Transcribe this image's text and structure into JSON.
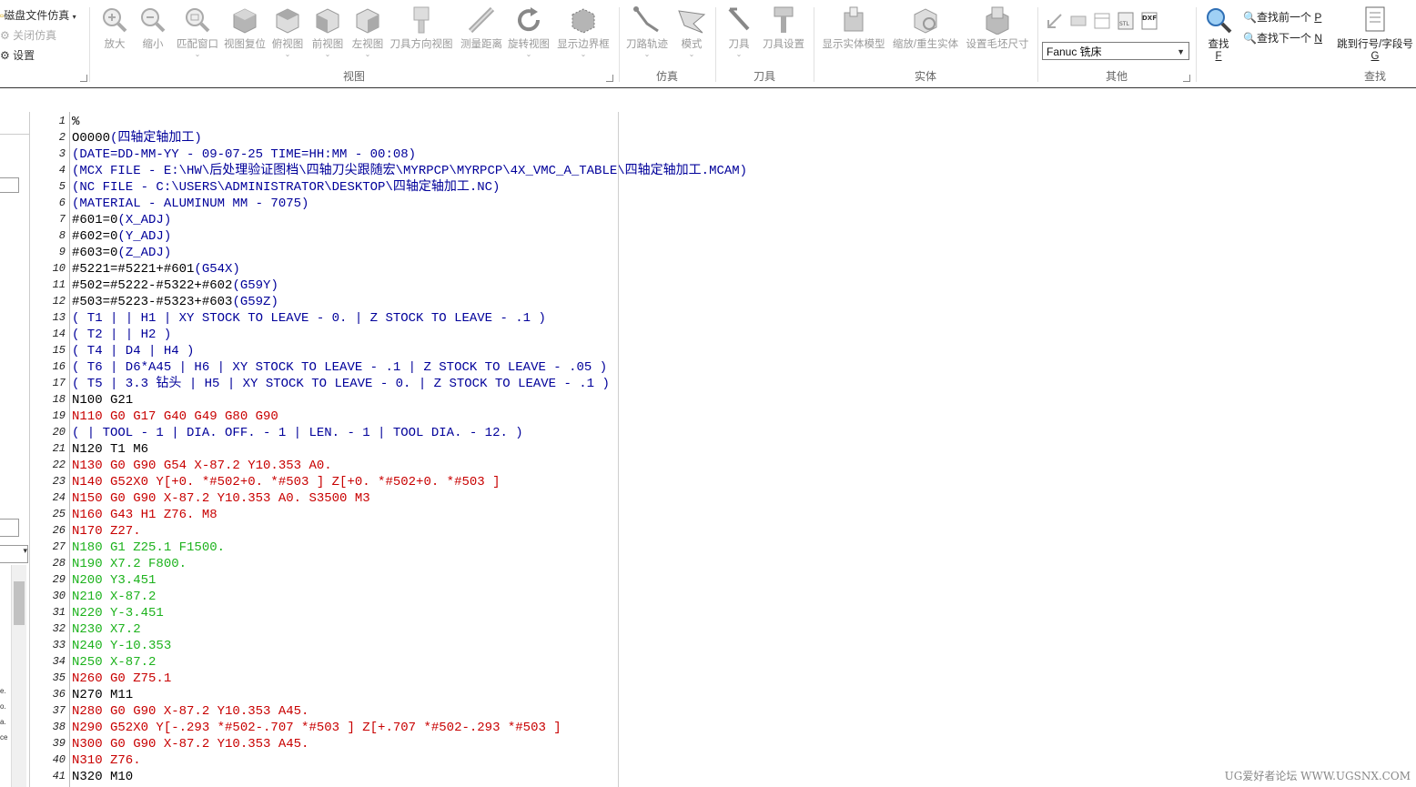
{
  "ribbon": {
    "left_menu": [
      "磁盘文件仿真",
      "关闭仿真",
      "设置"
    ],
    "view_buttons": [
      "放大",
      "缩小",
      "匹配窗口",
      "视图复位",
      "俯视图",
      "前视图",
      "左视图",
      "刀具方向视图",
      "测量距离",
      "旋转视图",
      "显示边界框"
    ],
    "view_group": "视图",
    "sim_buttons": [
      "刀路轨迹",
      "模式"
    ],
    "sim_group": "仿真",
    "tool_buttons": [
      "刀具",
      "刀具设置"
    ],
    "tool_group": "刀具",
    "solid_buttons": [
      "显示实体模型",
      "缩放/重生实体",
      "设置毛坯尺寸"
    ],
    "solid_group": "实体",
    "other_group": "其他",
    "machine_select": "Fanuc 铣床",
    "find_button": "查找",
    "find_key": "F",
    "find_prev": "查找前一个",
    "find_prev_key": "P",
    "find_next": "查找下一个",
    "find_next_key": "N",
    "goto_button": "跳到行号/字段号",
    "goto_key": "G",
    "find_group": "查找"
  },
  "left_panel_snippets": [
    "e.",
    "o.",
    "a.",
    "ce"
  ],
  "code_lines": [
    {
      "n": "1",
      "segs": [
        [
          "%",
          "blk"
        ]
      ]
    },
    {
      "n": "2",
      "segs": [
        [
          "O0000",
          "blk"
        ],
        [
          "(四轴定轴加工)",
          "blu"
        ]
      ]
    },
    {
      "n": "3",
      "segs": [
        [
          "(DATE=DD-MM-YY - 09-07-25 TIME=HH:MM - 00:08)",
          "blu"
        ]
      ]
    },
    {
      "n": "4",
      "segs": [
        [
          "(MCX FILE - E:\\HW\\后处理验证图档\\四轴刀尖跟随宏\\MYRPCP\\MYRPCP\\4X_VMC_A_TABLE\\四轴定轴加工.MCAM)",
          "blu"
        ]
      ]
    },
    {
      "n": "5",
      "segs": [
        [
          "(NC FILE - C:\\USERS\\ADMINISTRATOR\\DESKTOP\\四轴定轴加工.NC)",
          "blu"
        ]
      ]
    },
    {
      "n": "6",
      "segs": [
        [
          "(MATERIAL - ALUMINUM MM - 7075)",
          "blu"
        ]
      ]
    },
    {
      "n": "7",
      "segs": [
        [
          "#601=0",
          "blk"
        ],
        [
          "(X_ADJ)",
          "blu"
        ]
      ]
    },
    {
      "n": "8",
      "segs": [
        [
          "#602=0",
          "blk"
        ],
        [
          "(Y_ADJ)",
          "blu"
        ]
      ]
    },
    {
      "n": "9",
      "segs": [
        [
          "#603=0",
          "blk"
        ],
        [
          "(Z_ADJ)",
          "blu"
        ]
      ]
    },
    {
      "n": "10",
      "segs": [
        [
          "#5221=#5221+#601",
          "blk"
        ],
        [
          "(G54X)",
          "blu"
        ]
      ]
    },
    {
      "n": "11",
      "segs": [
        [
          "#502=#5222-#5322+#602",
          "blk"
        ],
        [
          "(G59Y)",
          "blu"
        ]
      ]
    },
    {
      "n": "12",
      "segs": [
        [
          "#503=#5223-#5323+#603",
          "blk"
        ],
        [
          "(G59Z)",
          "blu"
        ]
      ]
    },
    {
      "n": "13",
      "segs": [
        [
          "( T1 | | H1 | XY STOCK TO LEAVE - 0. | Z STOCK TO LEAVE - .1 )",
          "blu"
        ]
      ]
    },
    {
      "n": "14",
      "segs": [
        [
          "( T2 | | H2 )",
          "blu"
        ]
      ]
    },
    {
      "n": "15",
      "segs": [
        [
          "( T4 | D4 | H4 )",
          "blu"
        ]
      ]
    },
    {
      "n": "16",
      "segs": [
        [
          "( T6 | D6*A45 | H6 | XY STOCK TO LEAVE - .1 | Z STOCK TO LEAVE - .05 )",
          "blu"
        ]
      ]
    },
    {
      "n": "17",
      "segs": [
        [
          "( T5 | 3.3 钻头 | H5 | XY STOCK TO LEAVE - 0. | Z STOCK TO LEAVE - .1 )",
          "blu"
        ]
      ]
    },
    {
      "n": "18",
      "segs": [
        [
          "N100 G21",
          "blk"
        ]
      ]
    },
    {
      "n": "19",
      "segs": [
        [
          "N110 G0 G17 G40 G49 G80 G90",
          "red"
        ]
      ]
    },
    {
      "n": "20",
      "segs": [
        [
          "( | TOOL - 1 | DIA. OFF. - 1 | LEN. - 1 | TOOL DIA. - 12. )",
          "blu"
        ]
      ]
    },
    {
      "n": "21",
      "segs": [
        [
          "N120 T1 M6",
          "blk"
        ]
      ]
    },
    {
      "n": "22",
      "segs": [
        [
          "N130 G0 G90 G54 X-87.2 Y10.353 A0.",
          "red"
        ]
      ]
    },
    {
      "n": "23",
      "segs": [
        [
          "N140 G52X0 Y[+0. *#502+0. *#503 ] Z[+0. *#502+0. *#503 ]",
          "red"
        ]
      ]
    },
    {
      "n": "24",
      "segs": [
        [
          "N150 G0 G90 X-87.2 Y10.353 A0. S3500 M3",
          "red"
        ]
      ]
    },
    {
      "n": "25",
      "segs": [
        [
          "N160 G43 H1 Z76. M8",
          "red"
        ]
      ]
    },
    {
      "n": "26",
      "segs": [
        [
          "N170 Z27.",
          "red"
        ]
      ]
    },
    {
      "n": "27",
      "segs": [
        [
          "N180 G1 Z25.1 F1500.",
          "grn"
        ]
      ]
    },
    {
      "n": "28",
      "segs": [
        [
          "N190 X7.2 F800.",
          "grn"
        ]
      ]
    },
    {
      "n": "29",
      "segs": [
        [
          "N200 Y3.451",
          "grn"
        ]
      ]
    },
    {
      "n": "30",
      "segs": [
        [
          "N210 X-87.2",
          "grn"
        ]
      ]
    },
    {
      "n": "31",
      "segs": [
        [
          "N220 Y-3.451",
          "grn"
        ]
      ]
    },
    {
      "n": "32",
      "segs": [
        [
          "N230 X7.2",
          "grn"
        ]
      ]
    },
    {
      "n": "33",
      "segs": [
        [
          "N240 Y-10.353",
          "grn"
        ]
      ]
    },
    {
      "n": "34",
      "segs": [
        [
          "N250 X-87.2",
          "grn"
        ]
      ]
    },
    {
      "n": "35",
      "segs": [
        [
          "N260 G0 Z75.1",
          "red"
        ]
      ]
    },
    {
      "n": "36",
      "segs": [
        [
          "N270 M11",
          "blk"
        ]
      ]
    },
    {
      "n": "37",
      "segs": [
        [
          "N280 G0 G90 X-87.2 Y10.353 A45.",
          "red"
        ]
      ]
    },
    {
      "n": "38",
      "segs": [
        [
          "N290 G52X0 Y[-.293 *#502-.707 *#503 ] Z[+.707 *#502-.293 *#503 ]",
          "red"
        ]
      ]
    },
    {
      "n": "39",
      "segs": [
        [
          "N300 G0 G90 X-87.2 Y10.353 A45.",
          "red"
        ]
      ]
    },
    {
      "n": "40",
      "segs": [
        [
          "N310 Z76.",
          "red"
        ]
      ]
    },
    {
      "n": "41",
      "segs": [
        [
          "N320 M10",
          "blk"
        ]
      ]
    }
  ],
  "watermark": "UG爱好者论坛 WWW.UGSNX.COM",
  "colors": {
    "blk": "#000000",
    "blu": "#00009a",
    "red": "#c80000",
    "grn": "#1cb21c"
  }
}
